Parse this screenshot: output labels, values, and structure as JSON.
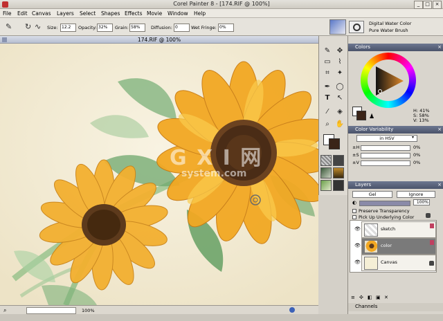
{
  "window": {
    "title": "Corel Painter 8 - [174.RIF @ 100%]"
  },
  "menu": [
    "File",
    "Edit",
    "Canvas",
    "Layers",
    "Select",
    "Shapes",
    "Effects",
    "Movie",
    "Window",
    "Help"
  ],
  "propbar": {
    "size_label": "Size:",
    "size_value": "12.2",
    "opacity_label": "Opacity:",
    "opacity_value": "32%",
    "grain_label": "Grain:",
    "grain_value": "58%",
    "diffusion_label": "Diffusion:",
    "diffusion_value": "0",
    "wetfringe_label": "Wet Fringe:",
    "wetfringe_value": "0%",
    "brush_category": "Digital Water Color",
    "brush_variant": "Pure Water Brush"
  },
  "document": {
    "title": "174.RIF @ 100%",
    "zoom": "100%"
  },
  "colors_panel": {
    "title": "Colors",
    "h_label": "H:",
    "h_value": "41%",
    "s_label": "S:",
    "s_value": "58%",
    "v_label": "V:",
    "v_value": "13%",
    "primary_color": "#3a2418",
    "secondary_color": "#ffffff"
  },
  "color_variability": {
    "title": "Color Variability",
    "mode": "in HSV",
    "rows": [
      {
        "label": "±H",
        "value": "0%"
      },
      {
        "label": "±S",
        "value": "0%"
      },
      {
        "label": "±V",
        "value": "0%"
      }
    ]
  },
  "layers_panel": {
    "title": "Layers",
    "composite_method": "Gel",
    "composite_depth": "Ignore",
    "opacity": "100%",
    "preserve_transparency": "Preserve Transparency",
    "pick_up_underlying": "Pick Up Underlying Color",
    "layers": [
      {
        "name": "sketch",
        "selected": false
      },
      {
        "name": "color",
        "selected": true
      },
      {
        "name": "Canvas",
        "selected": false
      }
    ],
    "channels_label": "Channels"
  },
  "watermark": {
    "line1": "G X I 网",
    "line2": "system.com"
  }
}
